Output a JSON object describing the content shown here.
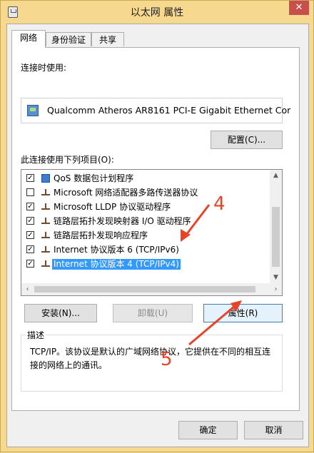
{
  "window": {
    "title": "以太网 属性",
    "close_label": "✕"
  },
  "tabs": [
    {
      "label": "网络",
      "active": true
    },
    {
      "label": "身份验证",
      "active": false
    },
    {
      "label": "共享",
      "active": false
    }
  ],
  "connect_using": {
    "label": "连接时使用:",
    "adapter": "Qualcomm Atheros AR8161 PCI-E Gigabit Ethernet Cor",
    "configure_button": "配置(C)..."
  },
  "items_list": {
    "label": "此连接使用下列项目(O):",
    "items": [
      {
        "label": "QoS 数据包计划程序",
        "checked": true,
        "icon": "qos-icon"
      },
      {
        "label": "Microsoft 网络适配器多路传送器协议",
        "checked": false,
        "icon": "protocol-icon"
      },
      {
        "label": "Microsoft LLDP 协议驱动程序",
        "checked": true,
        "icon": "protocol-icon"
      },
      {
        "label": "链路层拓扑发现映射器 I/O 驱动程序",
        "checked": true,
        "icon": "protocol-icon"
      },
      {
        "label": "链路层拓扑发现响应程序",
        "checked": true,
        "icon": "protocol-icon"
      },
      {
        "label": "Internet 协议版本 6 (TCP/IPv6)",
        "checked": true,
        "icon": "protocol-icon"
      },
      {
        "label": "Internet 协议版本 4 (TCP/IPv4)",
        "checked": true,
        "icon": "protocol-icon",
        "selected": true
      }
    ]
  },
  "action_buttons": {
    "install": "安装(N)...",
    "uninstall": "卸载(U)",
    "properties": "属性(R)"
  },
  "description": {
    "title": "描述",
    "text": "TCP/IP。该协议是默认的广域网络协议，它提供在不同的相互连接的网络上的通讯。"
  },
  "dialog_buttons": {
    "ok": "确定",
    "cancel": "取消"
  },
  "annotations": {
    "step4": "4",
    "step5": "5",
    "color": "#e84327"
  }
}
